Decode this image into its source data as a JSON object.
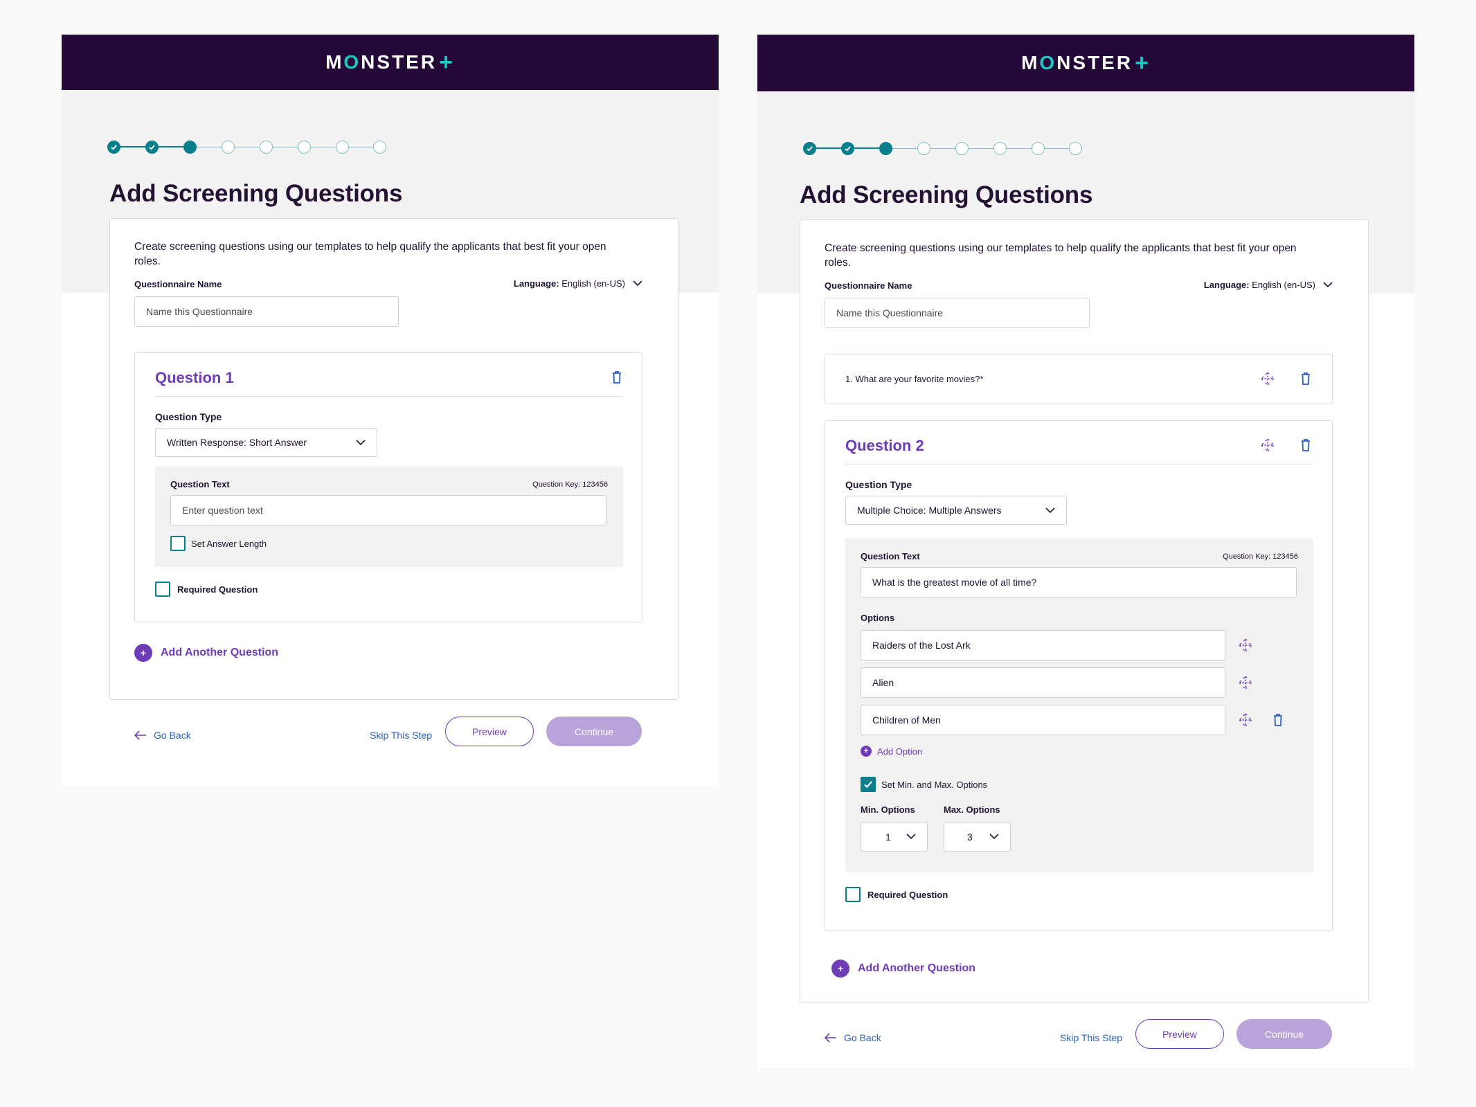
{
  "brand": {
    "logo_left": "M",
    "logo_o": "O",
    "logo_rest": "NSTER",
    "logo_plus": "+",
    "colors": {
      "header": "#240837",
      "accent": "#6e3cb4",
      "teal": "#087f8c",
      "link": "#2d5fbc"
    }
  },
  "left": {
    "title": "Add Screening Questions",
    "intro": "Create screening questions using our templates to help qualify the applicants that best fit your open roles.",
    "questionnaire_label": "Questionnaire Name",
    "language_label": "Language:",
    "language_value": "English (en-US)",
    "name_placeholder": "Name this Questionnaire",
    "question": {
      "title": "Question 1",
      "type_label": "Question Type",
      "type_value": "Written Response: Short Answer",
      "text_label": "Question Text",
      "key": "Question Key: 123456",
      "text_placeholder": "Enter question text",
      "answer_length_label": "Set Answer Length",
      "required_label": "Required Question"
    },
    "add_question": "Add Another Question",
    "go_back": "Go Back",
    "skip": "Skip This Step",
    "preview": "Preview",
    "continue": "Continue"
  },
  "right": {
    "title": "Add Screening Questions",
    "intro": "Create screening questions using our templates to help qualify the applicants that best fit your open roles.",
    "questionnaire_label": "Questionnaire Name",
    "language_label": "Language:",
    "language_value": "English (en-US)",
    "name_placeholder": "Name this Questionnaire",
    "collapsed_question": "1. What are your favorite movies?*",
    "question": {
      "title": "Question 2",
      "type_label": "Question Type",
      "type_value": "Multiple Choice: Multiple Answers",
      "text_label": "Question Text",
      "key": "Question Key: 123456",
      "text_value": "What is the greatest movie of all time?",
      "options_label": "Options",
      "options": [
        "Raiders of the Lost Ark",
        "Alien",
        "Children of Men"
      ],
      "add_option": "Add Option",
      "minmax_label": "Set Min. and Max. Options",
      "min_label": "Min. Options",
      "min_value": "1",
      "max_label": "Max. Options",
      "max_value": "3",
      "required_label": "Required Question"
    },
    "add_question": "Add Another Question",
    "go_back": "Go Back",
    "skip": "Skip This Step",
    "preview": "Preview",
    "continue": "Continue"
  },
  "stepper": {
    "total_steps": 8,
    "completed": 2,
    "current": 3
  },
  "icons": [
    "check-icon",
    "trash-icon",
    "move-icon",
    "chevron-down-icon",
    "arrow-left-icon",
    "plus-icon"
  ]
}
